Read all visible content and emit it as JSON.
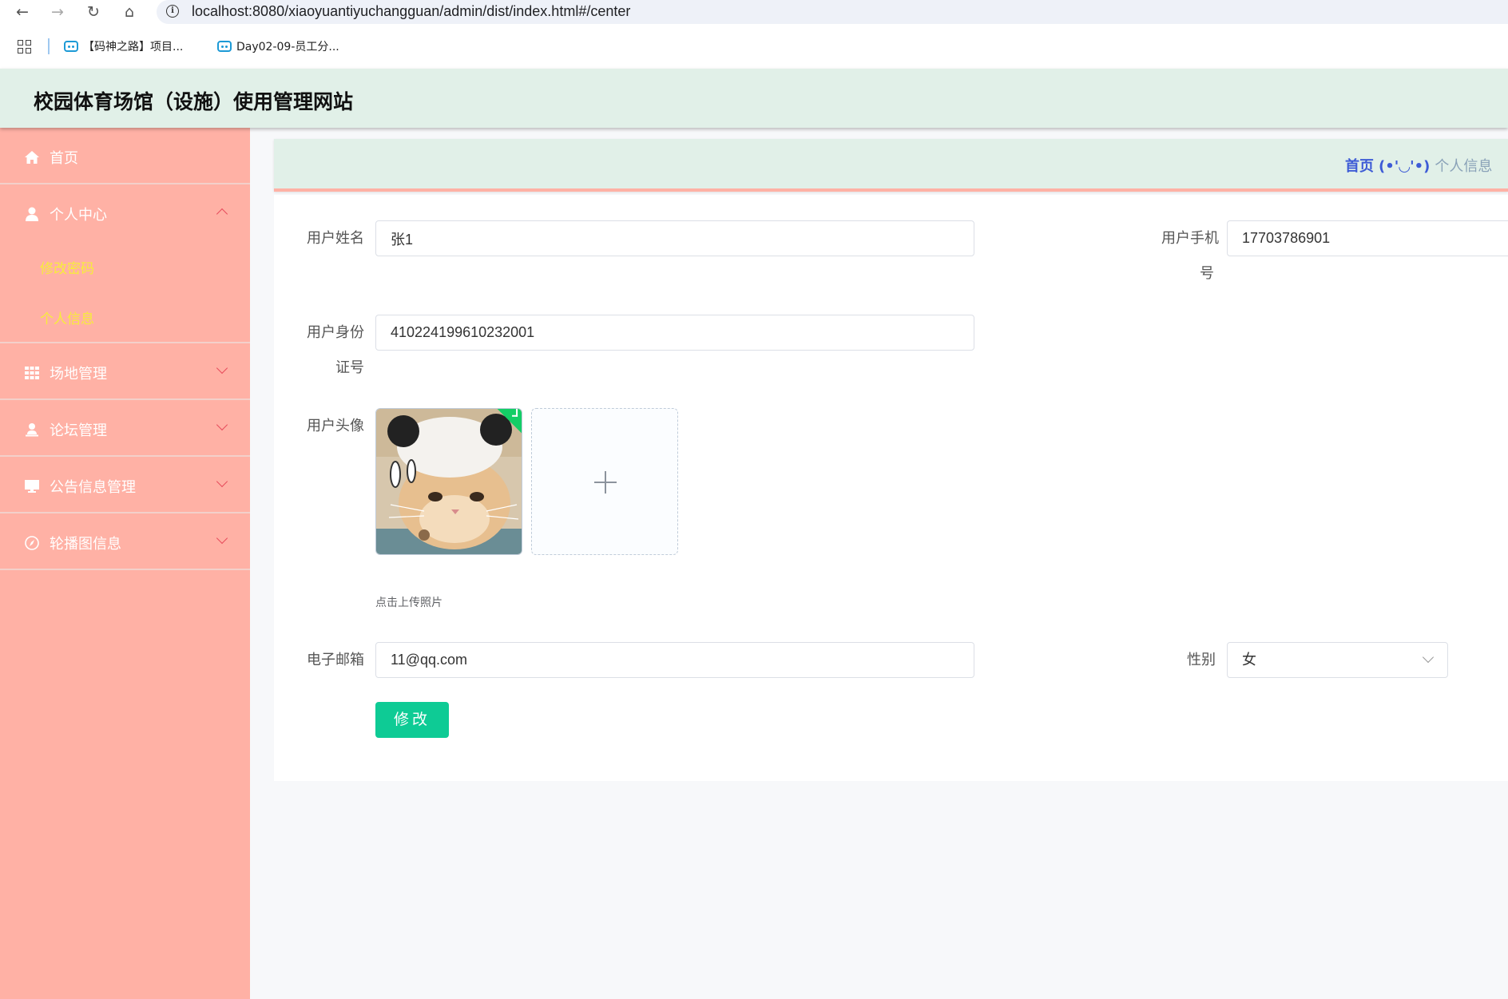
{
  "browser": {
    "url": "localhost:8080/xiaoyuantiyuchangguan/admin/dist/index.html#/center",
    "bookmarks": [
      "【码神之路】项目...",
      "Day02-09-员工分..."
    ]
  },
  "app": {
    "title": "校园体育场馆（设施）使用管理网站"
  },
  "sidebar": {
    "items": [
      {
        "label": "首页",
        "icon": "home-icon"
      },
      {
        "label": "个人中心",
        "icon": "user-icon",
        "expanded": true,
        "children": [
          "修改密码",
          "个人信息"
        ]
      },
      {
        "label": "场地管理",
        "icon": "grid-icon"
      },
      {
        "label": "论坛管理",
        "icon": "person-icon"
      },
      {
        "label": "公告信息管理",
        "icon": "monitor-icon"
      },
      {
        "label": "轮播图信息",
        "icon": "compass-icon"
      }
    ]
  },
  "breadcrumb": {
    "home": "首页",
    "separator": "(•'◡'•)",
    "current": "个人信息"
  },
  "form": {
    "name_label": "用户姓名",
    "name_value": "张1",
    "phone_label_line1": "用户手机",
    "phone_label_line2": "号",
    "phone_value": "17703786901",
    "id_label_line1": "用户身份",
    "id_label_line2": "证号",
    "id_value": "410224199610232001",
    "avatar_label": "用户头像",
    "upload_tip": "点击上传照片",
    "email_label": "电子邮箱",
    "email_value": "11@qq.com",
    "gender_label": "性别",
    "gender_value": "女",
    "submit_label": "修改"
  },
  "colors": {
    "sidebar": "#ffb1a5",
    "header": "#e1f0e8",
    "submenu_text": "#f7ed3a",
    "button": "#0ecb95",
    "breadcrumb_home": "#3d5bd6"
  }
}
